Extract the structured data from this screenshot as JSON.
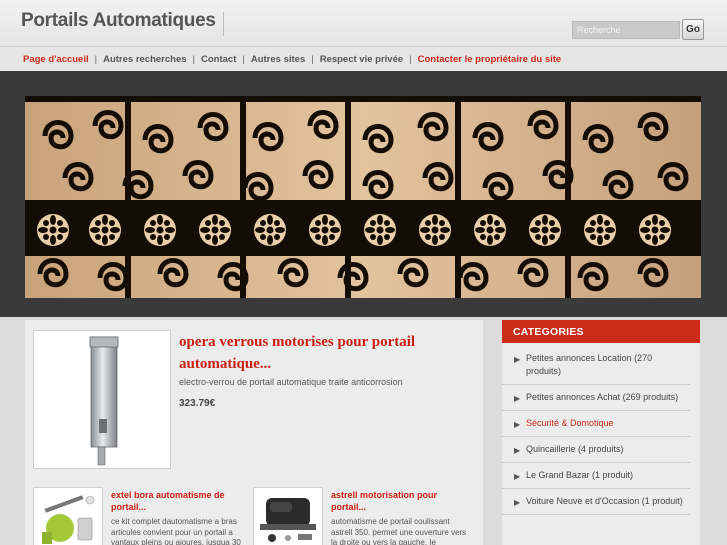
{
  "header": {
    "site_title": "Portails Automatiques",
    "search_placeholder": "Recherche",
    "go_label": "Go"
  },
  "nav": {
    "items": [
      {
        "label": "Page d'accueil",
        "accent": true
      },
      {
        "label": "Autres recherches",
        "accent": false
      },
      {
        "label": "Contact",
        "accent": false
      },
      {
        "label": "Autres sites",
        "accent": false
      },
      {
        "label": "Respect vie privée",
        "accent": false
      },
      {
        "label": "Contacter le propriétaire du site",
        "accent": true
      }
    ],
    "separator": "|"
  },
  "featured": {
    "title": "opera verrous motorises pour portail automatique...",
    "description": "electro-verrou de portail automatique traite anticorrosion",
    "price": "323.79€"
  },
  "cards": [
    {
      "title": "extel bora automatisme de portail...",
      "description": "ce kit complet dautomatisme a bras articules convient pour un portail a vantaux pleins ou ajoures, jusqua 30"
    },
    {
      "title": "astrell motorisation pour portail...",
      "description": "automatisme de portail coulissant astrell 350. permet une ouverture vers la droite ou vers la gauche. Ie"
    }
  ],
  "sidebar": {
    "header": "CATEGORIES",
    "bullet": "▶",
    "items": [
      {
        "label": "Petites annonces Location (270 produits)",
        "accent": false
      },
      {
        "label": "Petites annonces Achat (269 produits)",
        "accent": false
      },
      {
        "label": "Sécurité & Domotique",
        "accent": true
      },
      {
        "label": "Quincaillerie (4 produits)",
        "accent": false
      },
      {
        "label": "Le Grand Bazar (1 produit)",
        "accent": false
      },
      {
        "label": "Voiture Neuve et d'Occasion (1 produit)",
        "accent": false
      }
    ]
  },
  "colors": {
    "accent": "#cc2a1a",
    "banner_frame": "#3a3a3a"
  }
}
